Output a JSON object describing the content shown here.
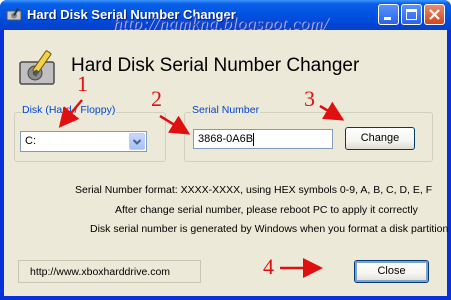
{
  "window": {
    "title": "Hard Disk Serial Number Changer"
  },
  "overlay": {
    "blog_url": "http://namkna.blogspot.com/",
    "markers": [
      "1",
      "2",
      "3",
      "4"
    ]
  },
  "app": {
    "heading": "Hard Disk Serial Number Changer"
  },
  "disk_group": {
    "label": "Disk (Hard / Floppy)",
    "selected_value": "C:"
  },
  "serial_group": {
    "label": "Serial Number",
    "value": "3868-0A6B",
    "change_label": "Change"
  },
  "info": {
    "line1": "Serial Number format: XXXX-XXXX, using HEX symbols 0-9, A, B, C, D, E, F",
    "line2": "After change serial number, please reboot PC to apply it correctly",
    "line3": "Disk serial number is generated by Windows when you format a disk partition"
  },
  "footer": {
    "website": "http://www.xboxharddrive.com",
    "close_label": "Close"
  },
  "colors": {
    "titlebar": "#0054e3",
    "client_bg": "#ece9d8",
    "group_label": "#0046d5",
    "marker_red": "#e01010"
  }
}
